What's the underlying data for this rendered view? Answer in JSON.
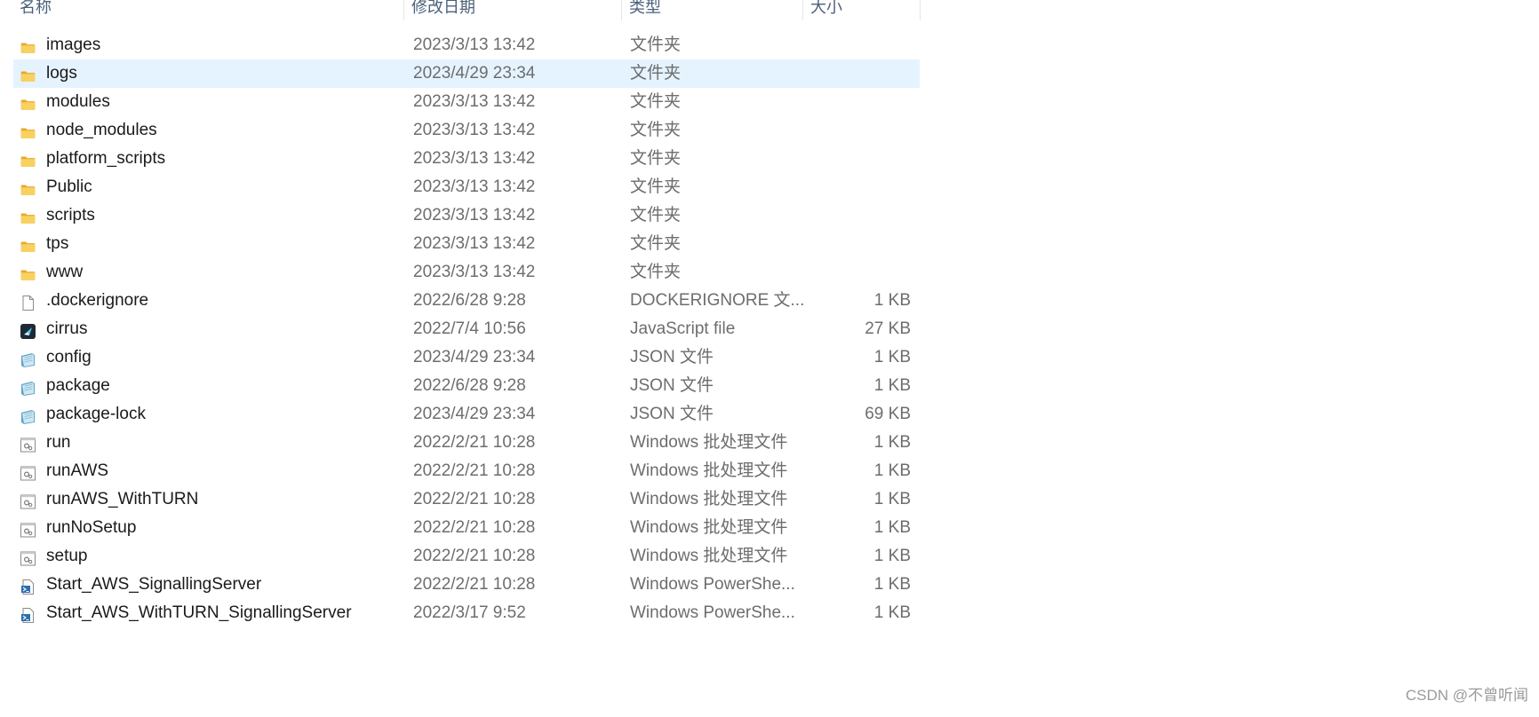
{
  "columns": {
    "name": "名称",
    "date": "修改日期",
    "type": "类型",
    "size": "大小"
  },
  "files": [
    {
      "name": "images",
      "date": "2023/3/13 13:42",
      "type": "文件夹",
      "size": "",
      "icon": "folder-icon"
    },
    {
      "name": "logs",
      "date": "2023/4/29 23:34",
      "type": "文件夹",
      "size": "",
      "icon": "folder-icon",
      "selected": true
    },
    {
      "name": "modules",
      "date": "2023/3/13 13:42",
      "type": "文件夹",
      "size": "",
      "icon": "folder-icon"
    },
    {
      "name": "node_modules",
      "date": "2023/3/13 13:42",
      "type": "文件夹",
      "size": "",
      "icon": "folder-icon"
    },
    {
      "name": "platform_scripts",
      "date": "2023/3/13 13:42",
      "type": "文件夹",
      "size": "",
      "icon": "folder-icon"
    },
    {
      "name": "Public",
      "date": "2023/3/13 13:42",
      "type": "文件夹",
      "size": "",
      "icon": "folder-icon"
    },
    {
      "name": "scripts",
      "date": "2023/3/13 13:42",
      "type": "文件夹",
      "size": "",
      "icon": "folder-icon"
    },
    {
      "name": "tps",
      "date": "2023/3/13 13:42",
      "type": "文件夹",
      "size": "",
      "icon": "folder-icon"
    },
    {
      "name": "www",
      "date": "2023/3/13 13:42",
      "type": "文件夹",
      "size": "",
      "icon": "folder-icon"
    },
    {
      "name": ".dockerignore",
      "date": "2022/6/28 9:28",
      "type": "DOCKERIGNORE 文...",
      "size": "1 KB",
      "icon": "blank-file-icon"
    },
    {
      "name": "cirrus",
      "date": "2022/7/4 10:56",
      "type": "JavaScript file",
      "size": "27 KB",
      "icon": "cirrus-icon"
    },
    {
      "name": "config",
      "date": "2023/4/29 23:34",
      "type": "JSON 文件",
      "size": "1 KB",
      "icon": "json-file-icon"
    },
    {
      "name": "package",
      "date": "2022/6/28 9:28",
      "type": "JSON 文件",
      "size": "1 KB",
      "icon": "json-file-icon"
    },
    {
      "name": "package-lock",
      "date": "2023/4/29 23:34",
      "type": "JSON 文件",
      "size": "69 KB",
      "icon": "json-file-icon"
    },
    {
      "name": "run",
      "date": "2022/2/21 10:28",
      "type": "Windows 批处理文件",
      "size": "1 KB",
      "icon": "batch-file-icon"
    },
    {
      "name": "runAWS",
      "date": "2022/2/21 10:28",
      "type": "Windows 批处理文件",
      "size": "1 KB",
      "icon": "batch-file-icon"
    },
    {
      "name": "runAWS_WithTURN",
      "date": "2022/2/21 10:28",
      "type": "Windows 批处理文件",
      "size": "1 KB",
      "icon": "batch-file-icon"
    },
    {
      "name": "runNoSetup",
      "date": "2022/2/21 10:28",
      "type": "Windows 批处理文件",
      "size": "1 KB",
      "icon": "batch-file-icon"
    },
    {
      "name": "setup",
      "date": "2022/2/21 10:28",
      "type": "Windows 批处理文件",
      "size": "1 KB",
      "icon": "batch-file-icon"
    },
    {
      "name": "Start_AWS_SignallingServer",
      "date": "2022/2/21 10:28",
      "type": "Windows PowerShe...",
      "size": "1 KB",
      "icon": "powershell-file-icon"
    },
    {
      "name": "Start_AWS_WithTURN_SignallingServer",
      "date": "2022/3/17 9:52",
      "type": "Windows PowerShe...",
      "size": "1 KB",
      "icon": "powershell-file-icon"
    }
  ],
  "watermark": "CSDN @不曾听闻",
  "colors": {
    "selected_row": "#e5f3ff",
    "header_text": "#4c607a",
    "meta_text": "#6d6d6d",
    "folder": "#f6c84a"
  }
}
